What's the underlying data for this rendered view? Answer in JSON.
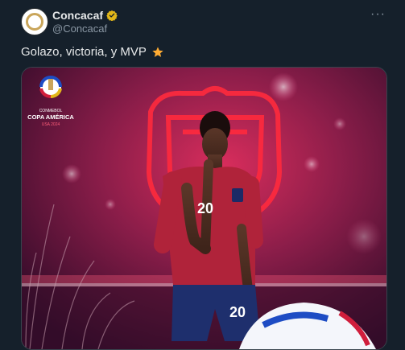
{
  "header": {
    "display_name": "Concacaf",
    "handle": "@Concacaf",
    "more_label": "···"
  },
  "tweet": {
    "text": "Golazo, victoria, y MVP"
  },
  "media": {
    "logo_small": "CONMEBOL",
    "logo_title": "COPA AMÉRICA",
    "logo_sub": "USA 2024",
    "jersey_number": "20",
    "shorts_number": "20"
  },
  "colors": {
    "background": "#15202b",
    "text": "#e7e9ea",
    "muted": "#8b98a5",
    "verified_gold": "#e2b719",
    "star": "#ffac33",
    "neon_red": "#ff2a3d",
    "jersey": "#b0233a"
  },
  "icons": {
    "verified": "verified-badge-icon",
    "star": "star-icon",
    "more": "more-options-icon"
  }
}
